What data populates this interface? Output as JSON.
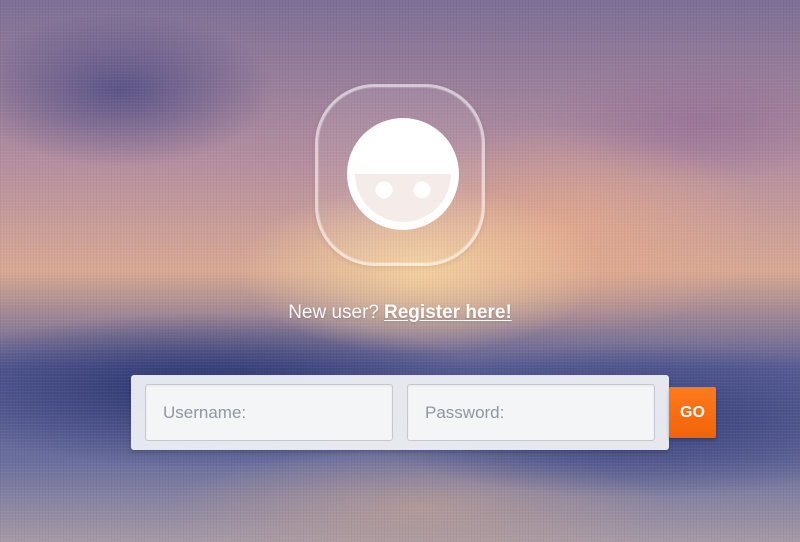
{
  "logo": {
    "icon": "smiling-face-icon",
    "color": "#ffffff"
  },
  "register": {
    "prompt": "New user?",
    "link_label": "Register here!"
  },
  "login_form": {
    "username_placeholder": "Username:",
    "password_placeholder": "Password:",
    "submit_label": "GO",
    "accent_color": "#ff6a0a"
  }
}
